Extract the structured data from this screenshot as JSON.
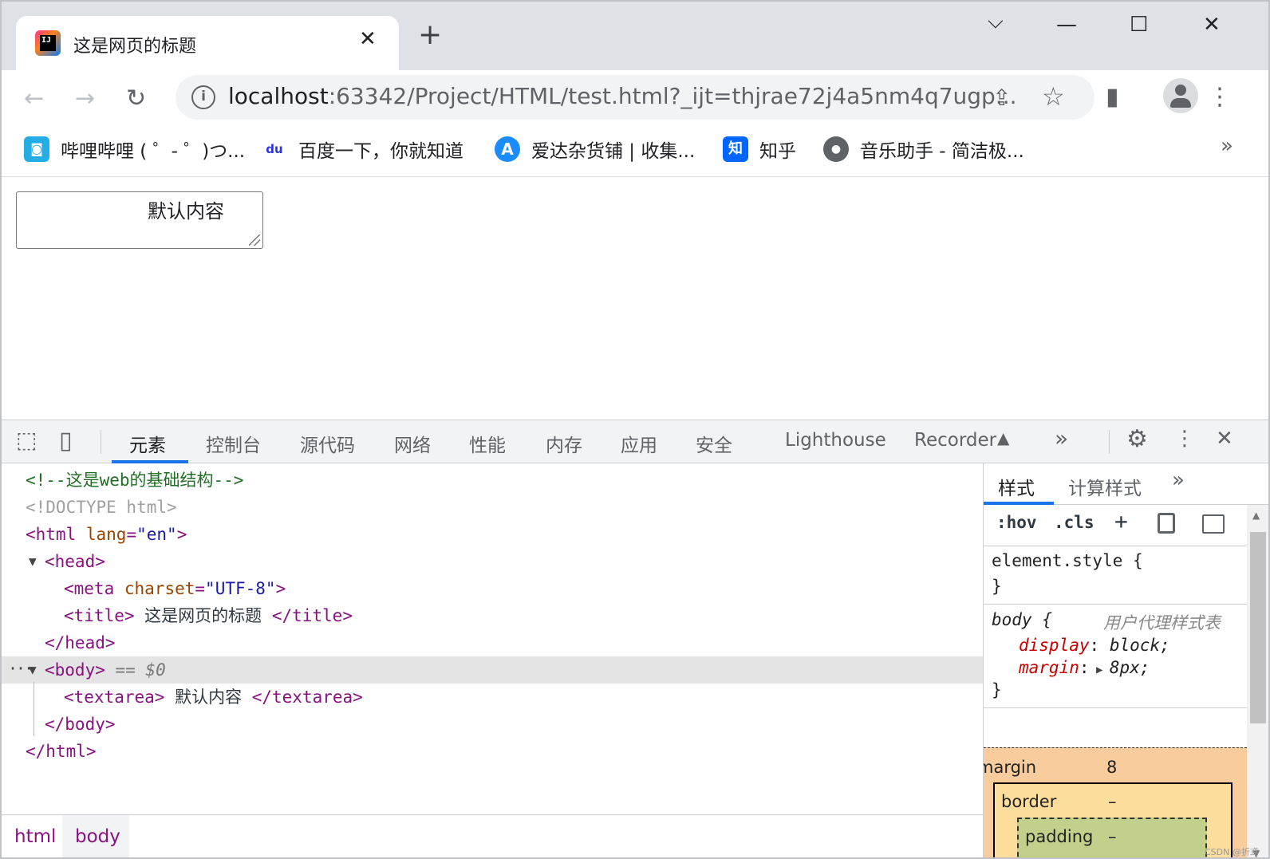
{
  "browser": {
    "tab_title": "这是网页的标题",
    "tab_close": "✕",
    "new_tab": "+",
    "window_controls": {
      "dropdown": "⌵",
      "minimize": "—",
      "maximize": "☐",
      "close": "✕"
    }
  },
  "toolbar": {
    "back": "←",
    "forward": "→",
    "reload": "↻",
    "url_host": "localhost",
    "url_rest": ":63342/Project/HTML/test.html?_ijt=thjrae72j4a5nm4q7ugp...",
    "share": "⇪",
    "star": "☆",
    "sidepanel": "▮",
    "menu": "⋮"
  },
  "bookmarks": {
    "items": [
      {
        "label": "哔哩哔哩 ( ゜- ゜)つ...",
        "icon": "bilibili-icon",
        "color": "#23ade5",
        "glyph": "◙"
      },
      {
        "label": "百度一下，你就知道",
        "icon": "baidu-icon",
        "color": "#2932e1",
        "glyph": "du"
      },
      {
        "label": "爱达杂货铺 | 收集...",
        "icon": "aida-icon",
        "color": "#1a8cff",
        "glyph": "A"
      },
      {
        "label": "知乎",
        "icon": "zhihu-icon",
        "color": "#0066ff",
        "glyph": "知"
      },
      {
        "label": "音乐助手 - 简洁极...",
        "icon": "globe-icon",
        "color": "#5f6368",
        "glyph": "●"
      }
    ],
    "more": "»"
  },
  "page": {
    "textarea_value": "默认内容"
  },
  "devtools": {
    "tabs": [
      "元素",
      "控制台",
      "源代码",
      "网络",
      "性能",
      "内存",
      "应用",
      "安全",
      "Lighthouse",
      "Recorder"
    ],
    "recorder_flask": "▲",
    "more_tabs": "»",
    "settings": "⚙",
    "kebab": "⋮",
    "close": "✕",
    "inspect_icon": "⬚",
    "device_icon": "▯",
    "dom": {
      "comment": "<!--这是web的基础结构-->",
      "doctype": "<!DOCTYPE html>",
      "html_open_tag": "<html",
      "html_attr": "lang",
      "html_attr_val": "\"en\"",
      "html_open_end": ">",
      "head_open": "<head>",
      "meta_tag": "<meta",
      "meta_attr": "charset",
      "meta_val": "\"UTF-8\"",
      "meta_end": ">",
      "title_open": "<title>",
      "title_text": " 这是网页的标题 ",
      "title_close": "</title>",
      "head_close": "</head>",
      "body_open": "<body>",
      "body_sel": " == $0",
      "textarea_open": "<textarea>",
      "textarea_text": " 默认内容 ",
      "textarea_close": "</textarea>",
      "body_close": "</body>",
      "html_close": "</html>",
      "equals": "=",
      "dots": "···"
    },
    "breadcrumbs": [
      "html",
      "body"
    ],
    "styles": {
      "tabs": [
        "样式",
        "计算样式"
      ],
      "more": "»",
      "hov": ":hov",
      "cls": ".cls",
      "plus": "+",
      "element_style": "element.style {",
      "close_brace": "}",
      "body_selector": "body {",
      "ua_label": "用户代理样式表",
      "display_prop": "display",
      "display_val": "block;",
      "margin_prop": "margin",
      "margin_val": "8px;",
      "colon": ":",
      "box": {
        "margin_label": "margin",
        "margin_val": "8",
        "border_label": "border",
        "border_val": "–",
        "padding_label": "padding",
        "padding_val": "–"
      }
    }
  },
  "watermark": "CSDN @折鸢"
}
